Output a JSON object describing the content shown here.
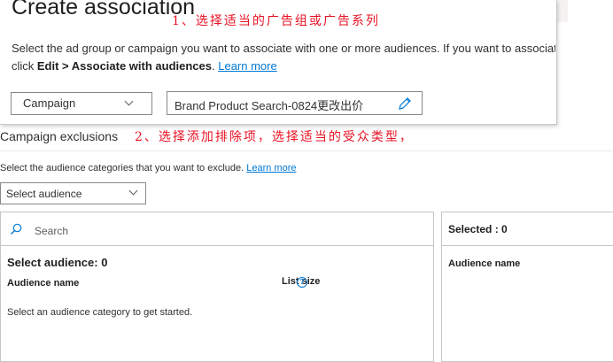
{
  "dialog": {
    "title": "Create association",
    "annotation_1": "1、选择适当的广告组或广告系列",
    "description_line1": "Select the ad group or campaign you want to associate with one or more audiences. If you want to associate w",
    "description_line2_prefix": "click ",
    "description_line2_bold": "Edit > Associate with audiences",
    "description_line2_suffix": ". ",
    "learn_more": "Learn more",
    "scope_dropdown": {
      "selected": "Campaign"
    },
    "campaign_input": {
      "value": "Brand Product Search-0824更改出价"
    }
  },
  "exclusions": {
    "title": "Campaign exclusions",
    "annotation_2": "2、选择添加排除项，选择适当的受众类型，",
    "description": "Select the audience categories that you want to exclude. ",
    "learn_more": "Learn more",
    "audience_dropdown": {
      "selected": "Select audience"
    },
    "search": {
      "placeholder": "Search"
    },
    "left_panel": {
      "heading": "Select audience:  0",
      "col_name": "Audience name",
      "col_size": "List size",
      "help": "?",
      "empty_message": "Select an audience category to get started."
    },
    "right_panel": {
      "heading": "Selected :  0",
      "col_name": "Audience name"
    }
  },
  "icons": [
    "chevron-down-icon",
    "pencil-icon",
    "search-icon",
    "help-icon"
  ],
  "colors": {
    "accent": "#0078d4",
    "annotation": "#e81123",
    "border": "#8a8886"
  }
}
